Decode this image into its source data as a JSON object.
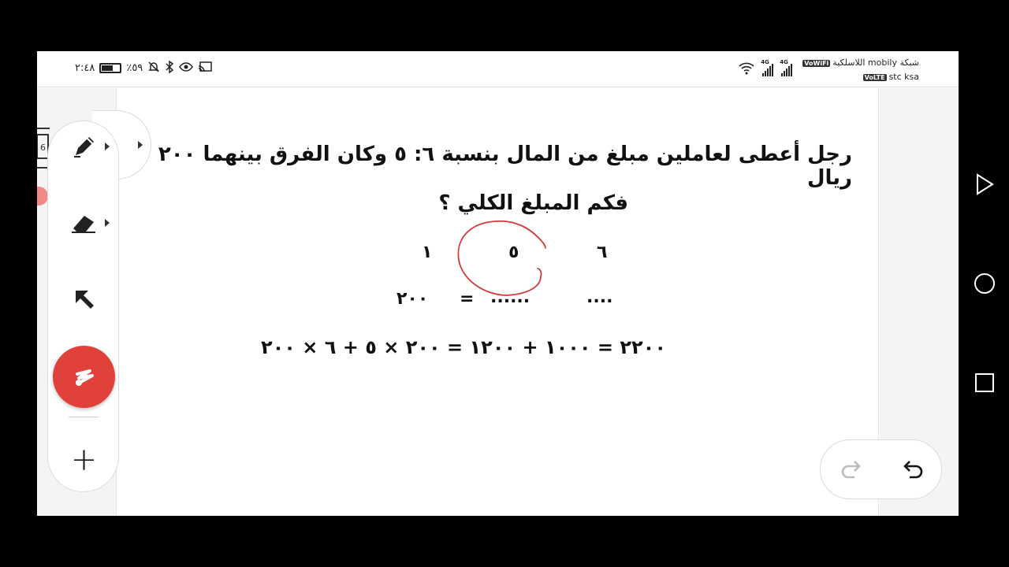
{
  "status_bar": {
    "time": "٢:٤٨",
    "battery_percent": "٪٥٩",
    "battery_level": 0.59,
    "carrier_line1": "شبكة mobily اللاسلكية",
    "carrier_line1_chip": "VoWiFi",
    "carrier_line2": "stc ksa",
    "carrier_line2_chip": "VoLTE",
    "network_label_1": "4G",
    "network_label_2": "4G"
  },
  "problem": {
    "line1": "رجل أعطى لعاملين مبلغ من المال بنسبة  ٦: ٥ وكان الفرق بينهما ٢٠٠ ريال",
    "line2": "فكم المبلغ الكلي ؟"
  },
  "work": {
    "ratio_1": "١",
    "ratio_5": "٥",
    "ratio_6": "٦",
    "row2_value": "٢٠٠",
    "row2_equals": "=",
    "row2_dots_a": "......",
    "row2_dots_b": "....",
    "equation": "٢٢٠٠ = ١٠٠٠  + ١٢٠٠  = ٢٠٠  × ٥ + ٦ × ٢٠٠"
  },
  "toolbar": {
    "tools": [
      "pen-tool",
      "eraser-tool",
      "select-tool",
      "laser-pointer-tool",
      "add-tool"
    ],
    "add_label": "+",
    "laser_color": "#e0413a",
    "edge_label": "6"
  },
  "annotation": {
    "circle_color": "#d33a3a"
  },
  "navigation": [
    "back-icon",
    "home-icon",
    "recents-icon"
  ]
}
